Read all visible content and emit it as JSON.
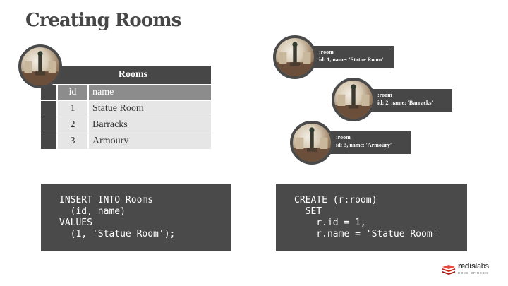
{
  "slide": {
    "title": "Creating Rooms"
  },
  "table": {
    "name": "Rooms",
    "columns": [
      "id",
      "name"
    ],
    "rows": [
      {
        "id": "1",
        "name": "Statue Room"
      },
      {
        "id": "2",
        "name": "Barracks"
      },
      {
        "id": "3",
        "name": "Armoury"
      }
    ]
  },
  "nodes": [
    {
      "label": ":room",
      "props": "id: 1, name: 'Statue Room'"
    },
    {
      "label": ":room",
      "props": "id: 2, name: 'Barracks'"
    },
    {
      "label": ":room",
      "props": "id: 3, name: 'Armoury'"
    }
  ],
  "code": {
    "sql": "INSERT INTO Rooms\n  (id, name)\nVALUES\n  (1, 'Statue Room');",
    "cypher": "CREATE (r:room)\n  SET\n    r.id = 1,\n    r.name = 'Statue Room'"
  },
  "logo": {
    "brand_a": "redis",
    "brand_b": "labs",
    "tagline": "HOME OF REDIS",
    "color": "#d82c20"
  }
}
